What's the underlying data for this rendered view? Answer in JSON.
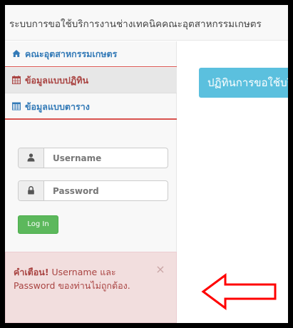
{
  "header": {
    "title": "ระบบการขอใช้บริการงานช่างเทคนิคคณะอุตสาหกรรมเกษตร"
  },
  "sidebar": {
    "items": [
      {
        "label": "คณะอุตสาหกรรมเกษตร",
        "icon": "home-icon"
      },
      {
        "label": "ข้อมูลแบบปฏิทิน",
        "icon": "calendar-icon"
      },
      {
        "label": "ข้อมูลแบบตาราง",
        "icon": "table-icon"
      }
    ]
  },
  "login": {
    "username_placeholder": "Username",
    "password_placeholder": "Password",
    "button_label": "Log In"
  },
  "alert": {
    "title": "คำเตือน!",
    "message": " Username และ Password ของท่านไม่ถูกต้อง.",
    "close_symbol": "×"
  },
  "main": {
    "calendar_title": "ปฏิทินการขอใช้บริการ"
  },
  "colors": {
    "link": "#337ab7",
    "active": "#a94442",
    "success": "#5cb85c",
    "info": "#5bc0de",
    "danger_bg": "#f2dede",
    "arrow": "#ff0000"
  }
}
